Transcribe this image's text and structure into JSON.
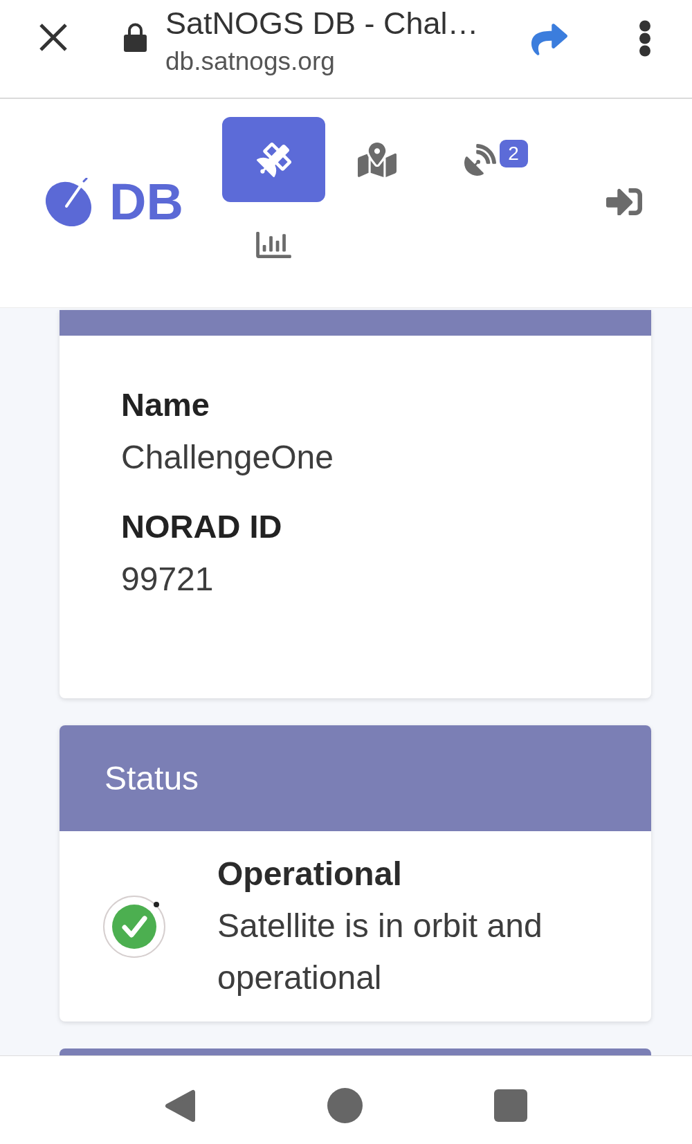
{
  "browser_bar": {
    "title": "SatNOGS DB - Chal…",
    "url": "db.satnogs.org"
  },
  "header": {
    "logo_text": "DB",
    "nav_items": [
      {
        "kind": "satellites",
        "selected": true
      },
      {
        "kind": "map",
        "selected": false
      },
      {
        "kind": "stations",
        "selected": false,
        "badge": "2"
      },
      {
        "kind": "statistics",
        "selected": false
      }
    ]
  },
  "satellite_card": {
    "fields": [
      {
        "label": "Name",
        "value": "ChallengeOne"
      },
      {
        "label": "NORAD ID",
        "value": "99721"
      }
    ]
  },
  "status_card": {
    "title": "Status",
    "status": {
      "kind": "operational",
      "name": "Operational",
      "description": "Satellite is in orbit and operational"
    }
  }
}
